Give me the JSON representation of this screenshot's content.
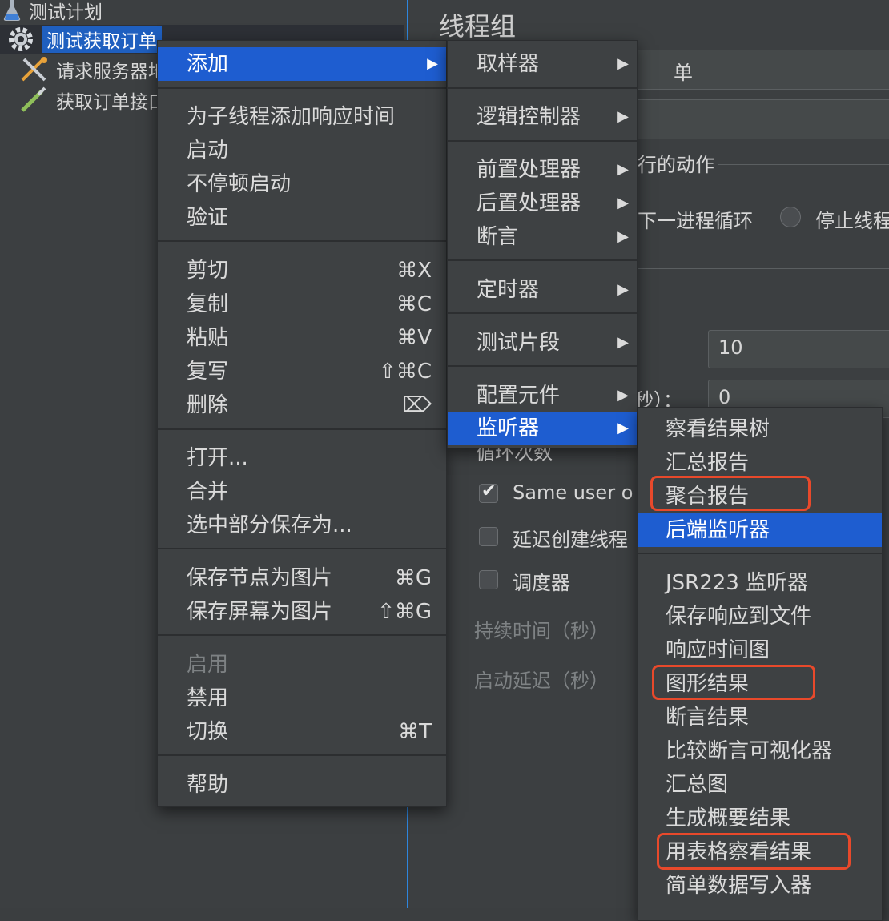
{
  "tree": {
    "items": [
      {
        "label": "测试计划"
      },
      {
        "label": "测试获取订单"
      },
      {
        "label": "请求服务器地"
      },
      {
        "label": "获取订单接口"
      }
    ]
  },
  "panel": {
    "title": "线程组",
    "name_fragment": "单",
    "action_label_fragment": "行的动作",
    "radio_label_1": "下一进程循环",
    "radio_label_2": "停止线程",
    "threads_value": "10",
    "rampup_label_fragment": "秒）：",
    "rampup_value": "0",
    "loop_label_fragment": "循环次数",
    "same_user_label": "Same user o",
    "delay_create_label": "延迟创建线程",
    "scheduler_label": "调度器",
    "duration_label": "持续时间（秒）",
    "startup_delay_label": "启动延迟（秒）"
  },
  "context_menu": {
    "add": "添加",
    "group1": [
      "为子线程添加响应时间",
      "启动",
      "不停顿启动",
      "验证"
    ],
    "edit": [
      {
        "label": "剪切",
        "shortcut": "⌘X"
      },
      {
        "label": "复制",
        "shortcut": "⌘C"
      },
      {
        "label": "粘贴",
        "shortcut": "⌘V"
      },
      {
        "label": "复写",
        "shortcut": "⇧⌘C"
      },
      {
        "label": "删除",
        "shortcut": "⌦"
      }
    ],
    "file": [
      "打开...",
      "合并",
      "选中部分保存为..."
    ],
    "image": [
      {
        "label": "保存节点为图片",
        "shortcut": "⌘G"
      },
      {
        "label": "保存屏幕为图片",
        "shortcut": "⇧⌘G"
      }
    ],
    "state": [
      {
        "label": "启用",
        "shortcut": ""
      },
      {
        "label": "禁用",
        "shortcut": ""
      },
      {
        "label": "切换",
        "shortcut": "⌘T"
      }
    ],
    "help": "帮助"
  },
  "add_submenu": {
    "items": [
      "取样器",
      "逻辑控制器",
      "前置处理器",
      "后置处理器",
      "断言",
      "定时器",
      "测试片段",
      "配置元件",
      "监听器"
    ]
  },
  "listener_submenu": {
    "items": [
      "察看结果树",
      "汇总报告",
      "聚合报告",
      "后端监听器",
      "JSR223 监听器",
      "保存响应到文件",
      "响应时间图",
      "图形结果",
      "断言结果",
      "比较断言可视化器",
      "汇总图",
      "生成概要结果",
      "用表格察看结果",
      "简单数据写入器"
    ]
  },
  "colors": {
    "selection": "#1e5dd0",
    "highlight_box": "#e8492b",
    "menu_bg": "#3e4143"
  }
}
